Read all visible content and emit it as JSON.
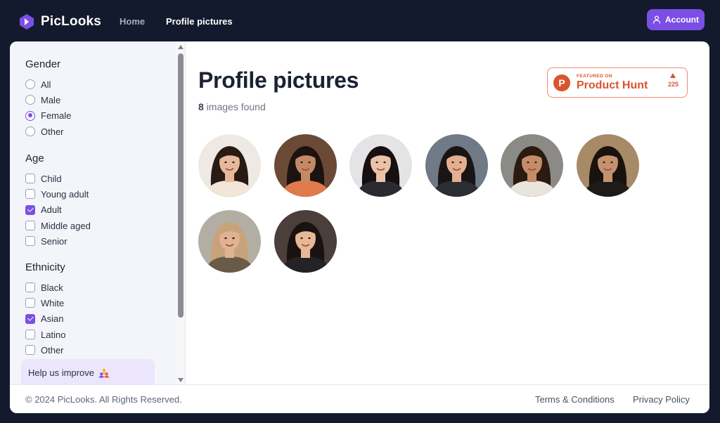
{
  "brand": {
    "name": "PicLooks",
    "accent": "#7b4ee6"
  },
  "nav": {
    "home": "Home",
    "profile_pictures": "Profile pictures"
  },
  "account": {
    "label": "Account",
    "icon": "user-icon"
  },
  "filters": {
    "gender": {
      "title": "Gender",
      "options": [
        {
          "label": "All",
          "selected": false
        },
        {
          "label": "Male",
          "selected": false
        },
        {
          "label": "Female",
          "selected": true
        },
        {
          "label": "Other",
          "selected": false
        }
      ]
    },
    "age": {
      "title": "Age",
      "options": [
        {
          "label": "Child",
          "checked": false
        },
        {
          "label": "Young adult",
          "checked": false
        },
        {
          "label": "Adult",
          "checked": true
        },
        {
          "label": "Middle aged",
          "checked": false
        },
        {
          "label": "Senior",
          "checked": false
        }
      ]
    },
    "ethnicity": {
      "title": "Ethnicity",
      "options": [
        {
          "label": "Black",
          "checked": false
        },
        {
          "label": "White",
          "checked": false
        },
        {
          "label": "Asian",
          "checked": true
        },
        {
          "label": "Latino",
          "checked": false
        },
        {
          "label": "Other",
          "checked": false
        }
      ]
    }
  },
  "help": {
    "label": "Help us improve",
    "icon": "people-icon"
  },
  "main": {
    "title": "Profile pictures",
    "count": "8",
    "count_suffix": " images found"
  },
  "product_hunt": {
    "kicker": "FEATURED ON",
    "name": "Product Hunt",
    "votes": "225",
    "color": "#da552f"
  },
  "images": [
    {
      "bg": "#efe9e4",
      "skin": "#e6b89c",
      "hair": "#2a1a14",
      "shirt": "#f1e6d8"
    },
    {
      "bg": "#6b4a35",
      "skin": "#c48a66",
      "hair": "#1c1210",
      "shirt": "#e07a4c"
    },
    {
      "bg": "#e4e4e6",
      "skin": "#ecc2a6",
      "hair": "#161012",
      "shirt": "#2a2a30"
    },
    {
      "bg": "#6f7a86",
      "skin": "#e2b090",
      "hair": "#1a1414",
      "shirt": "#2c2d33"
    },
    {
      "bg": "#8b8a86",
      "skin": "#c68c68",
      "hair": "#2a1a10",
      "shirt": "#e9e4dc"
    },
    {
      "bg": "#a78a66",
      "skin": "#c59170",
      "hair": "#1a120e",
      "shirt": "#1e1a18"
    },
    {
      "bg": "#b3aea4",
      "skin": "#e0b294",
      "hair": "#c8a27a",
      "shirt": "#6a5a48"
    },
    {
      "bg": "#4a3f3a",
      "skin": "#e6b896",
      "hair": "#1a1210",
      "shirt": "#242226"
    }
  ],
  "footer": {
    "copyright": "© 2024 PicLooks. All Rights Reserved.",
    "terms": "Terms & Conditions",
    "privacy": "Privacy Policy"
  }
}
